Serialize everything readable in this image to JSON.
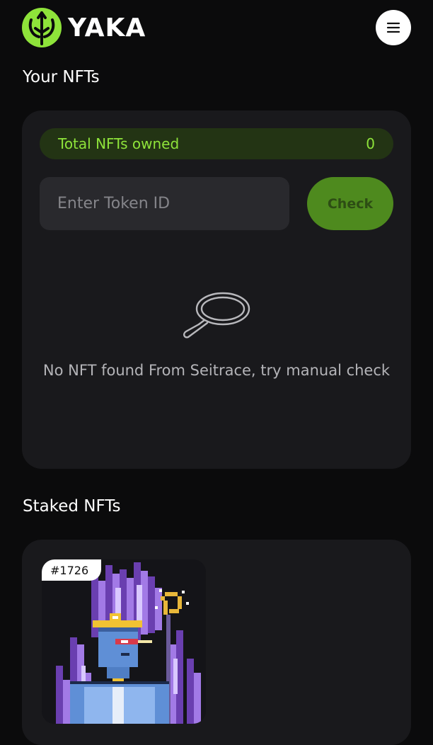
{
  "header": {
    "brand": "YAKA",
    "logo_icon": "yaka-trident-icon",
    "menu_icon": "hamburger-menu-icon",
    "accent_color": "#8ee33a"
  },
  "your_nfts": {
    "title": "Your NFTs",
    "total_label": "Total NFTs owned",
    "total_value": "0",
    "token_input_placeholder": "Enter Token ID",
    "token_input_value": "",
    "check_label": "Check",
    "empty_icon": "magnifying-glass-icon",
    "empty_message": "No NFT found From Seitrace, try manual check"
  },
  "staked_nfts": {
    "title": "Staked NFTs",
    "items": [
      {
        "badge": "#1726",
        "image": "pixel-art-warrior-nft"
      }
    ]
  }
}
